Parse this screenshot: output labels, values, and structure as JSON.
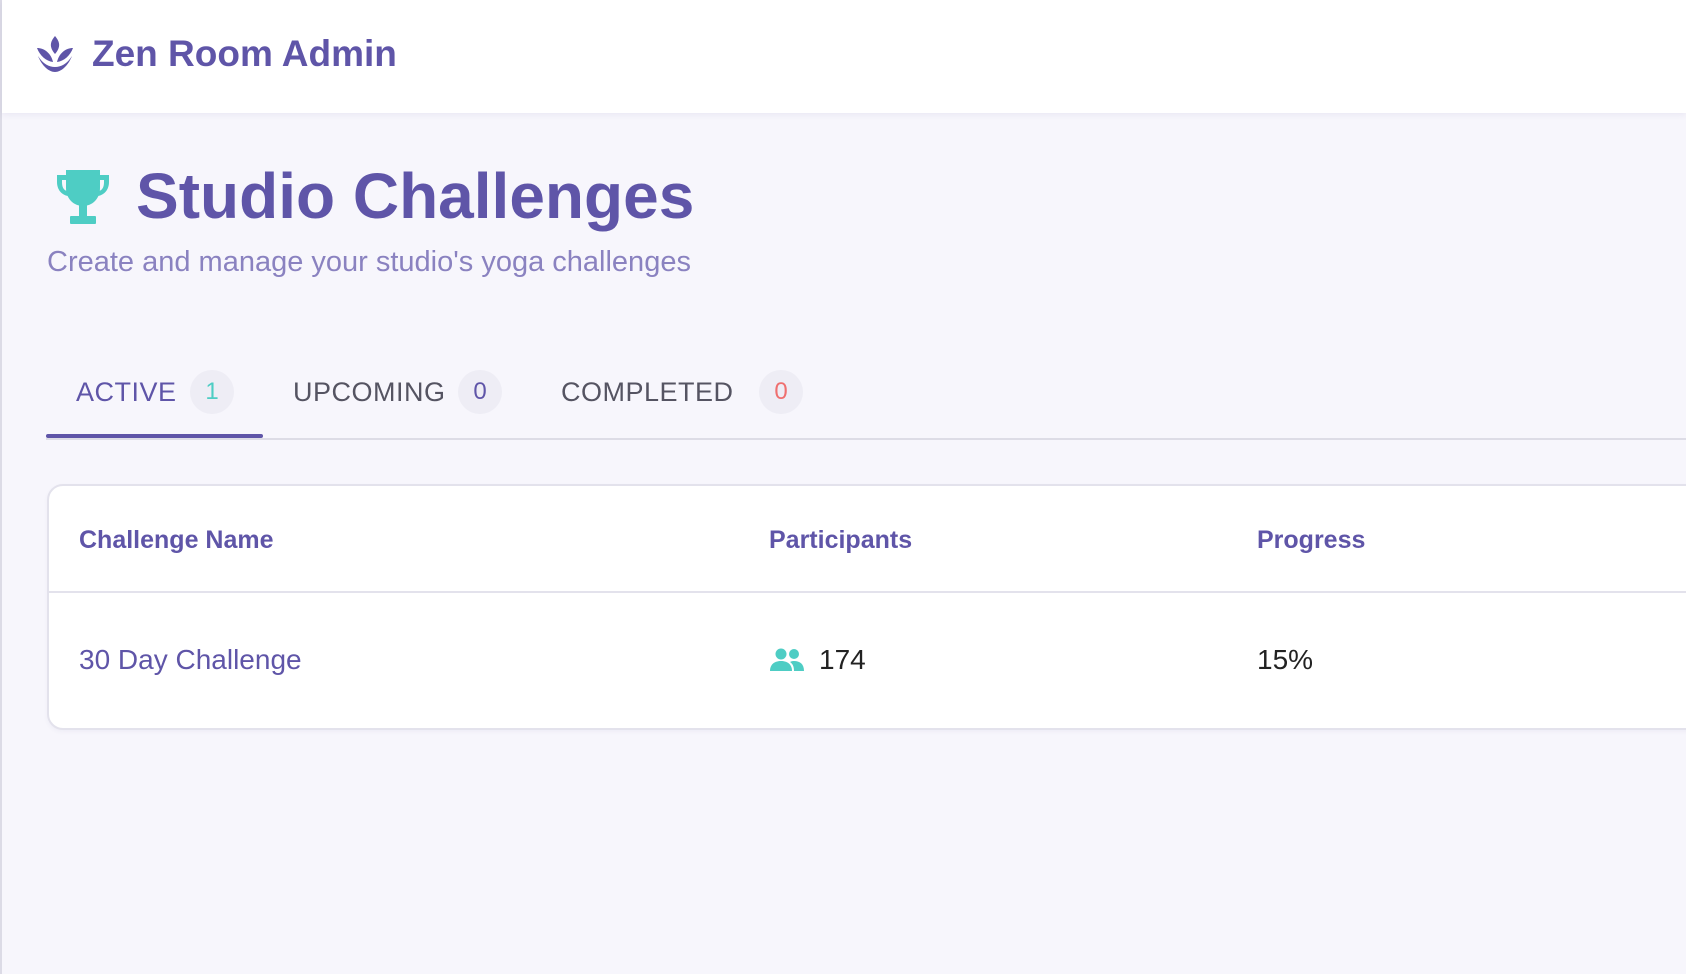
{
  "header": {
    "brand_title": "Zen Room Admin",
    "brand_icon": "lotus-icon",
    "brand_color": "#5f55a8"
  },
  "page": {
    "title": "Studio Challenges",
    "title_icon": "trophy-icon",
    "subtitle": "Create and manage your studio's yoga challenges",
    "accent_color": "#4ecdc4"
  },
  "tabs": [
    {
      "label": "ACTIVE",
      "count": "1",
      "active": true,
      "count_color": "#4ecdc4"
    },
    {
      "label": "UPCOMING",
      "count": "0",
      "active": false,
      "count_color": "#5f55a8"
    },
    {
      "label": "COMPLETED",
      "count": "0",
      "active": false,
      "count_color": "#ef6f6f"
    }
  ],
  "table": {
    "columns": [
      "Challenge Name",
      "Participants",
      "Progress"
    ],
    "rows": [
      {
        "name": "30 Day Challenge",
        "participants": "174",
        "participants_icon": "people-icon",
        "progress": "15%"
      }
    ]
  }
}
